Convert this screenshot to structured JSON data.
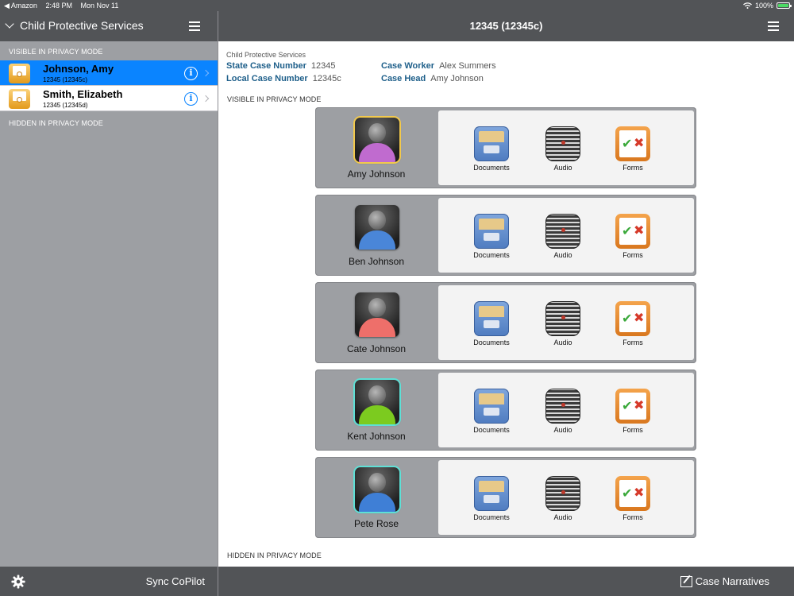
{
  "status_bar": {
    "back_app": "◀ Amazon",
    "time": "2:48 PM",
    "date": "Mon Nov 11",
    "battery": "100%"
  },
  "sidebar": {
    "title": "Child Protective Services",
    "visible_label": "VISIBLE IN PRIVACY MODE",
    "hidden_label": "HIDDEN IN PRIVACY MODE",
    "items": [
      {
        "name": "Johnson, Amy",
        "sub": "12345 (12345c)",
        "selected": true
      },
      {
        "name": "Smith, Elizabeth",
        "sub": "12345 (12345d)",
        "selected": false
      }
    ],
    "sync_label": "Sync CoPilot"
  },
  "main": {
    "title": "12345 (12345c)",
    "agency": "Child Protective Services",
    "state_case_label": "State Case Number",
    "state_case_value": "12345",
    "local_case_label": "Local Case Number",
    "local_case_value": "12345c",
    "case_worker_label": "Case Worker",
    "case_worker_value": "Alex Summers",
    "case_head_label": "Case Head",
    "case_head_value": "Amy Johnson",
    "visible_label": "VISIBLE IN PRIVACY MODE",
    "hidden_label": "HIDDEN IN PRIVACY MODE",
    "tool_labels": {
      "documents": "Documents",
      "audio": "Audio",
      "forms": "Forms"
    },
    "people": [
      {
        "name": "Amy Johnson",
        "shirt": "#c06bcf",
        "frame": "yellow"
      },
      {
        "name": "Ben Johnson",
        "shirt": "#4a86d8",
        "frame": "none"
      },
      {
        "name": "Cate Johnson",
        "shirt": "#ee6f6a",
        "frame": "none"
      },
      {
        "name": "Kent Johnson",
        "shirt": "#7ccb1f",
        "frame": "cyan"
      },
      {
        "name": "Pete Rose",
        "shirt": "#3f7fd6",
        "frame": "cyan"
      }
    ],
    "narratives_label": "Case Narratives"
  },
  "colors": {
    "accent": "#0a84ff",
    "bar": "#525457",
    "label_blue": "#1e5f8a"
  }
}
